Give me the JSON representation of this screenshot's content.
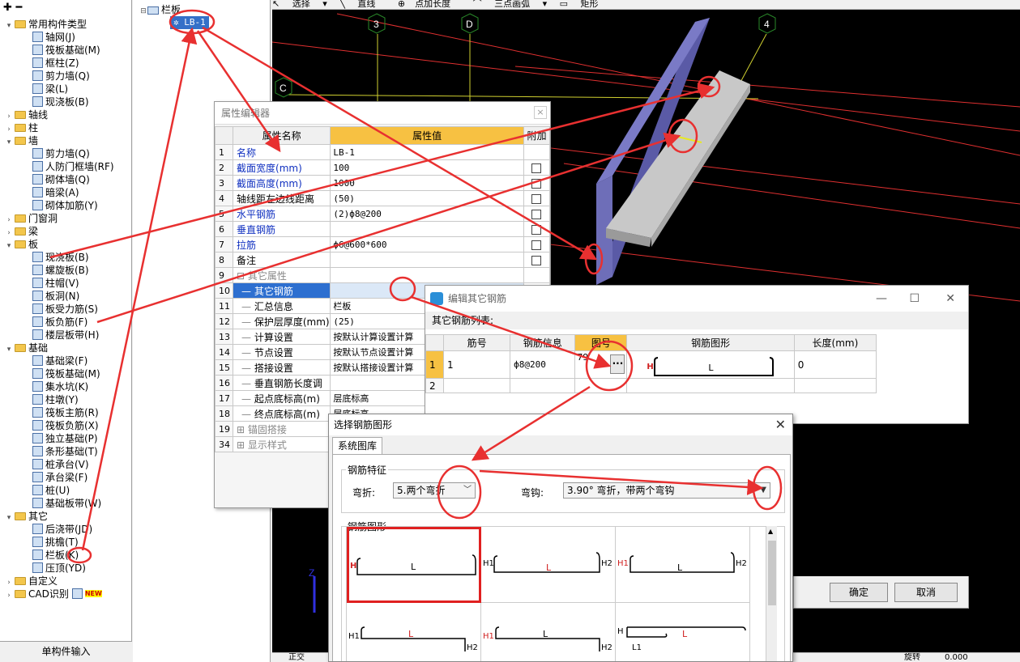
{
  "left_panel": {
    "toolbar_add": "✚",
    "toolbar_collapse": "━",
    "tree": [
      {
        "level": 0,
        "expanded": true,
        "label": "常用构件类型",
        "icon": "folder-icon"
      },
      {
        "level": 1,
        "label": "轴网(J)",
        "icon": "axis-grid-icon"
      },
      {
        "level": 1,
        "label": "筏板基础(M)",
        "icon": "raft-foundation-icon"
      },
      {
        "level": 1,
        "label": "框柱(Z)",
        "icon": "column-icon"
      },
      {
        "level": 1,
        "label": "剪力墙(Q)",
        "icon": "shear-wall-icon"
      },
      {
        "level": 1,
        "label": "梁(L)",
        "icon": "beam-icon"
      },
      {
        "level": 1,
        "label": "现浇板(B)",
        "icon": "slab-icon"
      },
      {
        "level": 0,
        "expanded": false,
        "label": "轴线",
        "icon": "folder-icon"
      },
      {
        "level": 0,
        "expanded": false,
        "label": "柱",
        "icon": "folder-icon"
      },
      {
        "level": 0,
        "expanded": true,
        "label": "墙",
        "icon": "folder-icon"
      },
      {
        "level": 1,
        "label": "剪力墙(Q)",
        "icon": "shear-wall-icon"
      },
      {
        "level": 1,
        "label": "人防门框墙(RF)",
        "icon": "door-frame-wall-icon"
      },
      {
        "level": 1,
        "label": "砌体墙(Q)",
        "icon": "masonry-wall-icon"
      },
      {
        "level": 1,
        "label": "暗梁(A)",
        "icon": "hidden-beam-icon"
      },
      {
        "level": 1,
        "label": "砌体加筋(Y)",
        "icon": "masonry-rebar-icon"
      },
      {
        "level": 0,
        "expanded": false,
        "label": "门窗洞",
        "icon": "folder-icon"
      },
      {
        "level": 0,
        "expanded": false,
        "label": "梁",
        "icon": "folder-icon"
      },
      {
        "level": 0,
        "expanded": true,
        "label": "板",
        "icon": "folder-icon"
      },
      {
        "level": 1,
        "label": "现浇板(B)",
        "icon": "slab-icon"
      },
      {
        "level": 1,
        "label": "螺旋板(B)",
        "icon": "spiral-slab-icon"
      },
      {
        "level": 1,
        "label": "柱帽(V)",
        "icon": "column-cap-icon"
      },
      {
        "level": 1,
        "label": "板洞(N)",
        "icon": "slab-hole-icon"
      },
      {
        "level": 1,
        "label": "板受力筋(S)",
        "icon": "slab-rebar-icon"
      },
      {
        "level": 1,
        "label": "板负筋(F)",
        "icon": "slab-neg-rebar-icon"
      },
      {
        "level": 1,
        "label": "楼层板带(H)",
        "icon": "floor-strip-icon"
      },
      {
        "level": 0,
        "expanded": true,
        "label": "基础",
        "icon": "folder-icon"
      },
      {
        "level": 1,
        "label": "基础梁(F)",
        "icon": "foundation-beam-icon"
      },
      {
        "level": 1,
        "label": "筏板基础(M)",
        "icon": "raft-foundation-icon"
      },
      {
        "level": 1,
        "label": "集水坑(K)",
        "icon": "sump-icon"
      },
      {
        "level": 1,
        "label": "柱墩(Y)",
        "icon": "pier-icon"
      },
      {
        "level": 1,
        "label": "筏板主筋(R)",
        "icon": "raft-main-rebar-icon"
      },
      {
        "level": 1,
        "label": "筏板负筋(X)",
        "icon": "raft-neg-rebar-icon"
      },
      {
        "level": 1,
        "label": "独立基础(P)",
        "icon": "isolated-foundation-icon"
      },
      {
        "level": 1,
        "label": "条形基础(T)",
        "icon": "strip-foundation-icon"
      },
      {
        "level": 1,
        "label": "桩承台(V)",
        "icon": "pile-cap-icon"
      },
      {
        "level": 1,
        "label": "承台梁(F)",
        "icon": "cap-beam-icon"
      },
      {
        "level": 1,
        "label": "桩(U)",
        "icon": "pile-icon"
      },
      {
        "level": 1,
        "label": "基础板带(W)",
        "icon": "foundation-strip-icon"
      },
      {
        "level": 0,
        "expanded": true,
        "label": "其它",
        "icon": "folder-icon"
      },
      {
        "level": 1,
        "label": "后浇带(JD)",
        "icon": "post-pour-icon"
      },
      {
        "level": 1,
        "label": "挑檐(T)",
        "icon": "cornice-icon"
      },
      {
        "level": 1,
        "label": "栏板(K)",
        "icon": "parapet-icon"
      },
      {
        "level": 1,
        "label": "压顶(YD)",
        "icon": "coping-icon"
      },
      {
        "level": 0,
        "expanded": false,
        "label": "自定义",
        "icon": "folder-icon"
      },
      {
        "level": 0,
        "expanded": false,
        "label": "CAD识别",
        "icon": "folder-icon",
        "badge": "NEW"
      }
    ],
    "bottom_button": "单构件输入"
  },
  "mid_panel": {
    "root_label": "栏板",
    "child_label": "LB-1"
  },
  "top_toolbar": {
    "select": "选择",
    "line": "直线",
    "point_length": "点加长度",
    "arc": "三点画弧",
    "rect": "矩形"
  },
  "bottom_status": {
    "left": "正交",
    "right": "旋转",
    "value": "0.000"
  },
  "viewport": {
    "axis_labels": [
      "3",
      "D",
      "4",
      "C"
    ],
    "z_label": "Z"
  },
  "prop_editor": {
    "title": "属性编辑器",
    "close": "×",
    "headers": {
      "name": "属性名称",
      "value": "属性值",
      "extra": "附加"
    },
    "rows": [
      {
        "n": "1",
        "name": "名称",
        "value": "LB-1",
        "blue": true,
        "check": false
      },
      {
        "n": "2",
        "name": "截面宽度(mm)",
        "value": "100",
        "blue": true,
        "check": true
      },
      {
        "n": "3",
        "name": "截面高度(mm)",
        "value": "1000",
        "blue": true,
        "check": true
      },
      {
        "n": "4",
        "name": "轴线距左边线距离",
        "value": "(50)",
        "blue": false,
        "check": true
      },
      {
        "n": "5",
        "name": "水平钢筋",
        "value": "(2)ф8@200",
        "blue": true,
        "check": true
      },
      {
        "n": "6",
        "name": "垂直钢筋",
        "value": "",
        "blue": true,
        "check": true
      },
      {
        "n": "7",
        "name": "拉筋",
        "value": "ф6@600*600",
        "blue": true,
        "check": true
      },
      {
        "n": "8",
        "name": "备注",
        "value": "",
        "blue": false,
        "check": true
      },
      {
        "n": "9",
        "name": "其它属性",
        "value": "",
        "group": true
      },
      {
        "n": "10",
        "name": "其它钢筋",
        "value": "",
        "sub": true,
        "selected": true
      },
      {
        "n": "11",
        "name": "汇总信息",
        "value": "栏板",
        "sub": true
      },
      {
        "n": "12",
        "name": "保护层厚度(mm)",
        "value": "(25)",
        "sub": true
      },
      {
        "n": "13",
        "name": "计算设置",
        "value": "按默认计算设置计算",
        "sub": true
      },
      {
        "n": "14",
        "name": "节点设置",
        "value": "按默认节点设置计算",
        "sub": true
      },
      {
        "n": "15",
        "name": "搭接设置",
        "value": "按默认搭接设置计算",
        "sub": true
      },
      {
        "n": "16",
        "name": "垂直钢筋长度调",
        "value": "",
        "sub": true
      },
      {
        "n": "17",
        "name": "起点底标高(m)",
        "value": "层底标高",
        "sub": true
      },
      {
        "n": "18",
        "name": "终点底标高(m)",
        "value": "层底标高",
        "sub": true
      },
      {
        "n": "19",
        "name": "锚固搭接",
        "value": "",
        "group": true,
        "plus": true
      },
      {
        "n": "34",
        "name": "显示样式",
        "value": "",
        "group": true,
        "plus": true
      }
    ]
  },
  "rebar_dialog": {
    "title": "编辑其它钢筋",
    "minimize": "—",
    "maximize": "☐",
    "close": "✕",
    "subtitle": "其它钢筋列表:",
    "headers": [
      "筋号",
      "钢筋信息",
      "图号",
      "钢筋图形",
      "长度(mm)"
    ],
    "rows": [
      {
        "n": "1",
        "bar_no": "1",
        "info": "ф8@200",
        "shape_no": "79",
        "shape_h": "H",
        "shape_l": "L",
        "length": "0"
      },
      {
        "n": "2",
        "bar_no": "",
        "info": "",
        "shape_no": "",
        "length": ""
      }
    ],
    "dots": "···"
  },
  "shape_dialog": {
    "title": "选择钢筋图形",
    "close": "✕",
    "tab": "系统图库",
    "feature_label": "钢筋特征",
    "bend_label": "弯折:",
    "bend_value": "5.两个弯折",
    "hook_label": "弯钩:",
    "hook_value": "3.90° 弯折，带两个弯钩",
    "shapes_label": "钢筋图形",
    "shapes": [
      {
        "labels": {
          "H": "H",
          "L": "L"
        }
      },
      {
        "labels": {
          "H1": "H1",
          "L": "L",
          "H2": "H2"
        }
      },
      {
        "labels": {
          "H1": "H1",
          "L": "L",
          "H2": "H2"
        }
      },
      {
        "labels": {
          "H1": "H1",
          "L": "L",
          "H2": "H2"
        }
      },
      {
        "labels": {
          "H1": "H1",
          "L": "L",
          "H2": "H2"
        }
      },
      {
        "labels": {
          "H": "H",
          "L": "L",
          "L1": "L1"
        }
      }
    ],
    "ok": "确定",
    "cancel": "取消"
  },
  "colors": {
    "accent_yellow": "#f7c142",
    "selection_blue": "#2d6fd0",
    "annotation_red": "#e83030",
    "parapet_purple": "#6b6bb0",
    "slab_gray": "#c8c8c8"
  }
}
